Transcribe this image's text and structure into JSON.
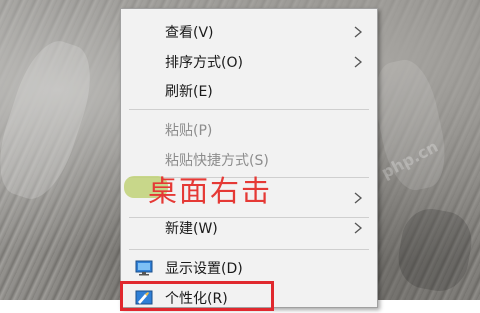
{
  "menu": {
    "items": [
      {
        "label": "查看(V)",
        "submenu": true,
        "disabled": false
      },
      {
        "label": "排序方式(O)",
        "submenu": true,
        "disabled": false
      },
      {
        "label": "刷新(E)",
        "submenu": false,
        "disabled": false
      },
      {
        "label": "粘贴(P)",
        "submenu": false,
        "disabled": true
      },
      {
        "label": "粘贴快捷方式(S)",
        "submenu": false,
        "disabled": true
      },
      {
        "label": "",
        "submenu": true,
        "disabled": false
      },
      {
        "label": "新建(W)",
        "submenu": true,
        "disabled": false
      },
      {
        "label": "显示设置(D)",
        "submenu": false,
        "disabled": false,
        "icon": "display-settings-icon"
      },
      {
        "label": "个性化(R)",
        "submenu": false,
        "disabled": false,
        "icon": "personalize-icon"
      }
    ]
  },
  "annotation": {
    "text": "桌面右击",
    "color": "#e53935"
  },
  "highlight": {
    "color": "#e0282e"
  },
  "watermark": {
    "text": "php.cn"
  }
}
